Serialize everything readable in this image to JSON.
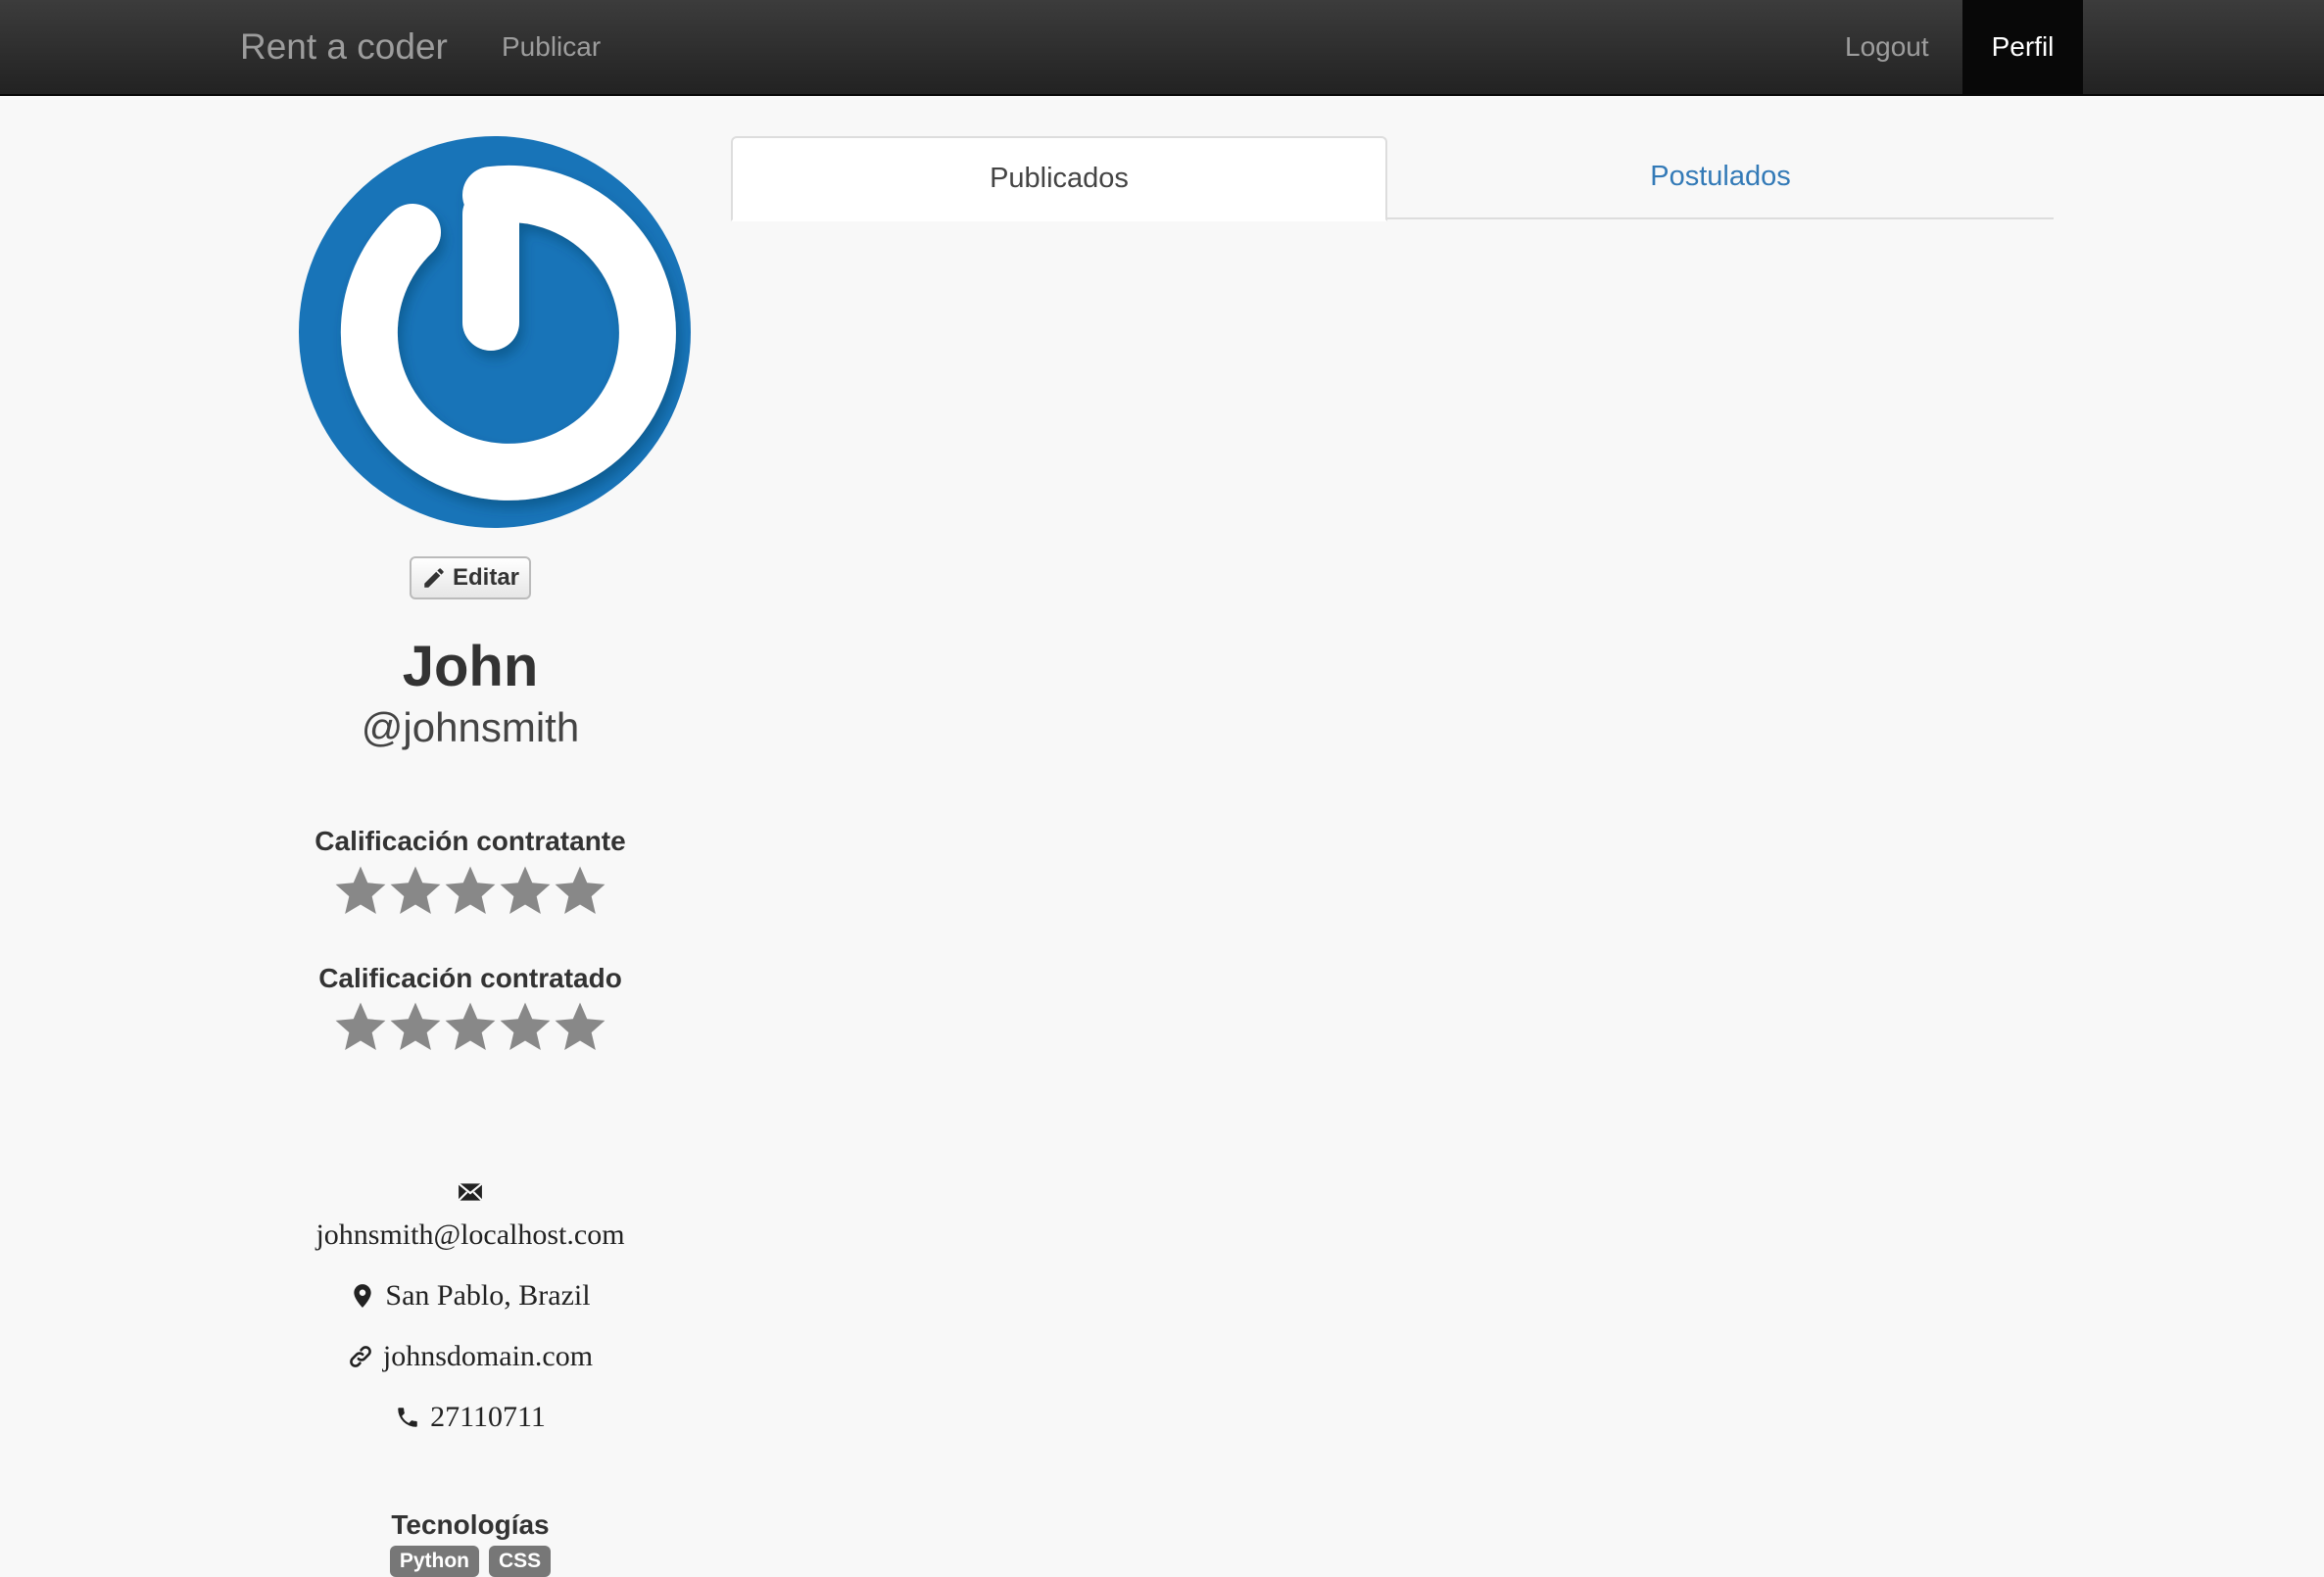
{
  "navbar": {
    "brand": "Rent a coder",
    "publish": "Publicar",
    "logout": "Logout",
    "profile": "Perfil"
  },
  "profile": {
    "edit_label": "Editar",
    "name": "John",
    "handle": "@johnsmith",
    "rating_employer_label": "Calificación contratante",
    "rating_employer_value": 0,
    "rating_contractor_label": "Calificación contratado",
    "rating_contractor_value": 0,
    "rating_max": 5,
    "email": "johnsmith@localhost.com",
    "location": "San Pablo, Brazil",
    "website": "johnsdomain.com",
    "phone": "27110711",
    "technologies_label": "Tecnologías",
    "technologies": [
      "Python",
      "CSS"
    ]
  },
  "tabs": [
    {
      "label": "Publicados",
      "active": true
    },
    {
      "label": "Postulados",
      "active": false
    }
  ],
  "colors": {
    "avatar_bg": "#1874b8",
    "link": "#337ab7",
    "star_empty": "#888888",
    "badge": "#777777"
  },
  "icons": {
    "edit": "pencil-icon",
    "email": "envelope-icon",
    "location": "map-marker-icon",
    "website": "link-icon",
    "phone": "phone-icon",
    "star": "star-icon"
  }
}
